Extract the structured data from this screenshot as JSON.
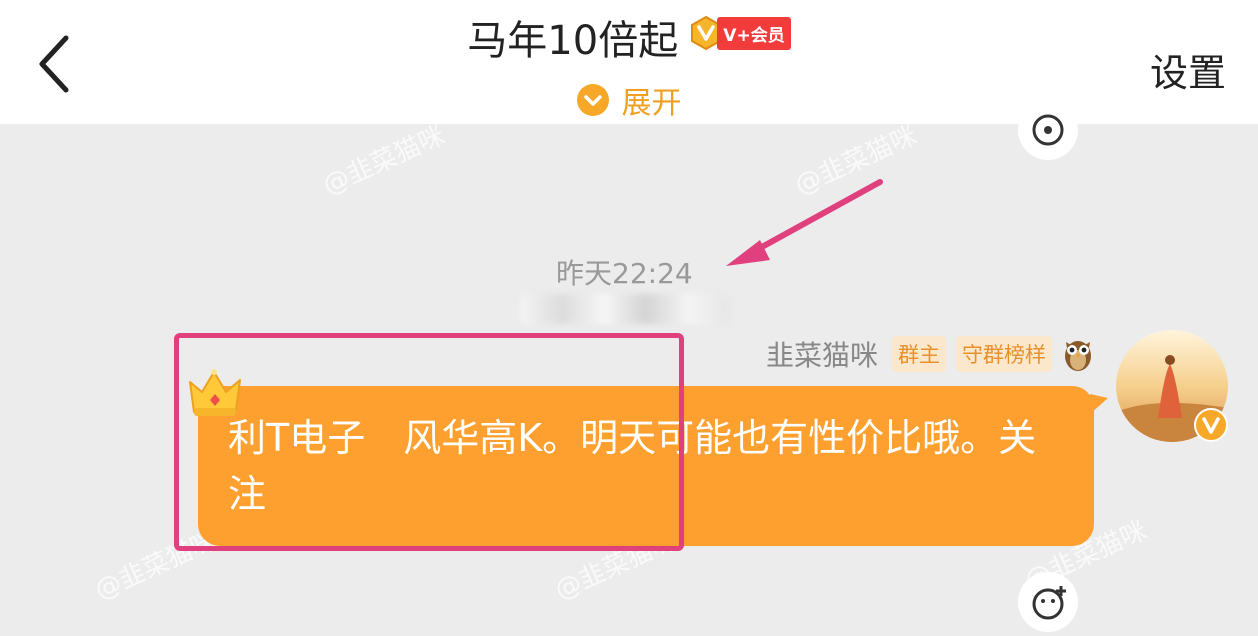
{
  "header": {
    "title": "马年10倍起",
    "vip_label": "V+会员",
    "expand_label": "展开",
    "settings_label": "设置"
  },
  "chat": {
    "timestamp": "昨天22:24",
    "message": {
      "sender": "韭菜猫咪",
      "tags": [
        "群主",
        "守群榜样"
      ],
      "text": "利T电子　风华高K。明天可能也有性价比哦。关注"
    }
  },
  "watermark_text": "@韭菜猫咪",
  "colors": {
    "bubble": "#fea02f",
    "accent": "#f0a020",
    "vip_red": "#f23c3c",
    "annotation": "#e0407e"
  },
  "icons": [
    "back-icon",
    "vip-icon",
    "chevron-down-icon",
    "crown-icon",
    "owl-icon",
    "emoji-icon",
    "add-emoji-icon",
    "verified-icon"
  ]
}
